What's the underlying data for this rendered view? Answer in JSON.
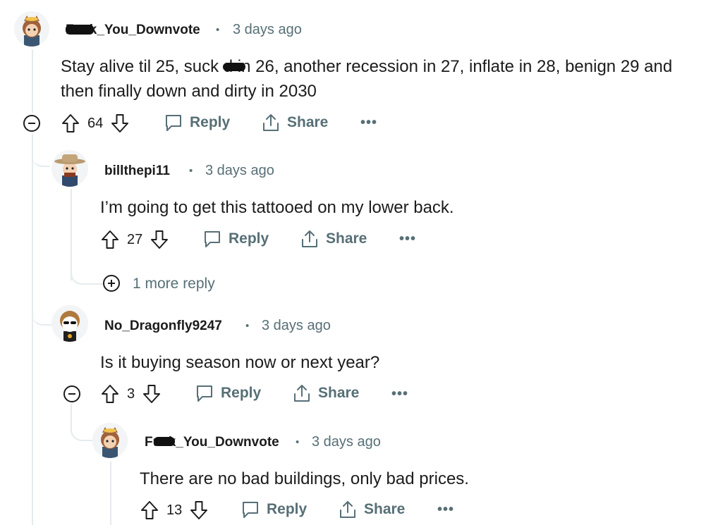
{
  "comments": [
    {
      "username": "Fuck_You_Downvote",
      "time": "3 days ago",
      "body_line1": "Stay alive til 25, suck d in 26, another recession in 27, inflate in 28, benign 29 and",
      "body_line2": "then finally down and dirty in 2030",
      "votes": "64",
      "reply_label": "Reply",
      "share_label": "Share",
      "more_label": "•••"
    },
    {
      "username": "billthepi11",
      "time": "3 days ago",
      "body_line1": "I’m going to get this tattooed on my lower back.",
      "votes": "27",
      "reply_label": "Reply",
      "share_label": "Share",
      "more_label": "•••"
    },
    {
      "more_replies": "1 more reply"
    },
    {
      "username": "No_Dragonfly9247",
      "time": "3 days ago",
      "body_line1": "Is it buying season now or next year?",
      "votes": "3",
      "reply_label": "Reply",
      "share_label": "Share",
      "more_label": "•••"
    },
    {
      "username": "Fuck_You_Downvote",
      "time": "3 days ago",
      "body_line1": "There are no bad buildings, only bad prices.",
      "votes": "13",
      "reply_label": "Reply",
      "share_label": "Share",
      "more_label": "•••"
    }
  ],
  "colors": {
    "meta": "#576f76",
    "text": "#1c1c1c",
    "thread": "#e5ebee"
  },
  "icons": [
    "upvote-icon",
    "downvote-icon",
    "comment-icon",
    "share-icon",
    "collapse-icon",
    "expand-icon"
  ]
}
